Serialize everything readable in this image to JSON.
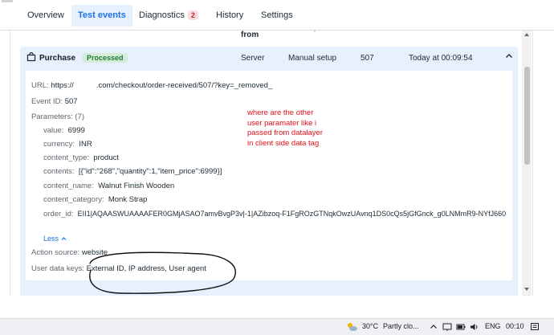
{
  "tabs": [
    {
      "label": "Overview"
    },
    {
      "label": "Test events",
      "active": true
    },
    {
      "label": "Diagnostics",
      "badge": "2"
    },
    {
      "label": "History"
    },
    {
      "label": "Settings"
    }
  ],
  "previous_row": {
    "from_label": "from"
  },
  "event": {
    "name": "Purchase",
    "status": "Processed",
    "source": "Server",
    "setup": "Manual setup",
    "count": "507",
    "time": "Today at 00:09:54",
    "url_label": "URL:",
    "url_prefix": "https://",
    "url_rest": ".com/checkout/order-received/507/?key=_removed_",
    "event_id_label": "Event ID:",
    "event_id": "507",
    "parameters_label": "Parameters:",
    "parameters_count": "(7)",
    "parameters": [
      {
        "key": "value:",
        "val": "6999"
      },
      {
        "key": "currency:",
        "val": "INR"
      },
      {
        "key": "content_type:",
        "val": "product"
      },
      {
        "key": "contents:",
        "val": "[{\"id\":\"268\",\"quantity\":1,\"item_price\":6999}]"
      },
      {
        "key": "content_name:",
        "val": "Walnut Finish Wooden"
      },
      {
        "key": "content_category:",
        "val": "Monk Strap"
      },
      {
        "key": "order_id:",
        "val": "EII1|AQAASWUAAAAFER0GMjASAO7amvBvgP3v|-1|AZibzoq-F1FgROzGTNqkOwzUAvnq1DS0cQs5jGfGnck_g0LNMmR9-NYfJ660"
      }
    ],
    "less_label": "Less",
    "action_source_label": "Action source:",
    "action_source": "website",
    "user_data_label": "User data keys:",
    "user_data": "External ID, IP address, User agent"
  },
  "annotation": {
    "lines": [
      "where are the other",
      "user paramater like i",
      "passed from datalayer",
      "in client side data tag"
    ],
    "color": "#e0101a"
  },
  "taskbar": {
    "weather_temp": "30°C",
    "weather_text": "Partly clo...",
    "language": "ENG",
    "time": "00:10"
  }
}
